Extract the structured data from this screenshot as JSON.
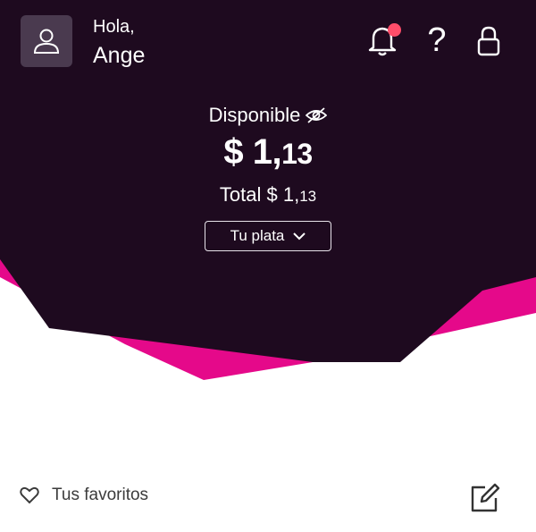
{
  "header": {
    "greeting": "Hola,",
    "user_name": "Ange",
    "icons": [
      "user-icon",
      "bell-icon",
      "question-icon",
      "lock-icon"
    ],
    "notification_dot_color": "#ff4d6a"
  },
  "balance": {
    "label": "Disponible",
    "available_symbol": "$",
    "available_int": " 1,",
    "available_dec": "13",
    "total_label": "Total $",
    "total_int": " 1,",
    "total_dec": "13",
    "account_selector": "Tu plata"
  },
  "favorites": {
    "label": "Tus favoritos"
  },
  "colors": {
    "hero_bg": "#1e0a1f",
    "accent_pink": "#e5098a",
    "text_dark": "#3b3b3b"
  }
}
